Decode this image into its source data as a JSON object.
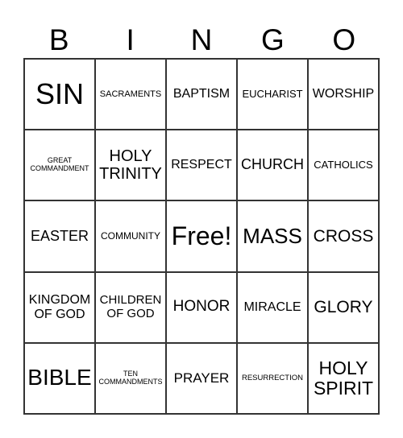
{
  "header": [
    "B",
    "I",
    "N",
    "G",
    "O"
  ],
  "cells": [
    "SIN",
    "SACRAMENTS",
    "BAPTISM",
    "EUCHARIST",
    "WORSHIP",
    "GREAT\nCOMMANDMENT",
    "HOLY\nTRINITY",
    "RESPECT",
    "CHURCH",
    "CATHOLICS",
    "EASTER",
    "COMMUNITY",
    "Free!",
    "MASS",
    "CROSS",
    "KINGDOM\nOF GOD",
    "CHILDREN\nOF GOD",
    "HONOR",
    "MIRACLE",
    "GLORY",
    "BIBLE",
    "TEN\nCOMMANDMENTS",
    "PRAYER",
    "RESURRECTION",
    "HOLY\nSPIRIT"
  ]
}
